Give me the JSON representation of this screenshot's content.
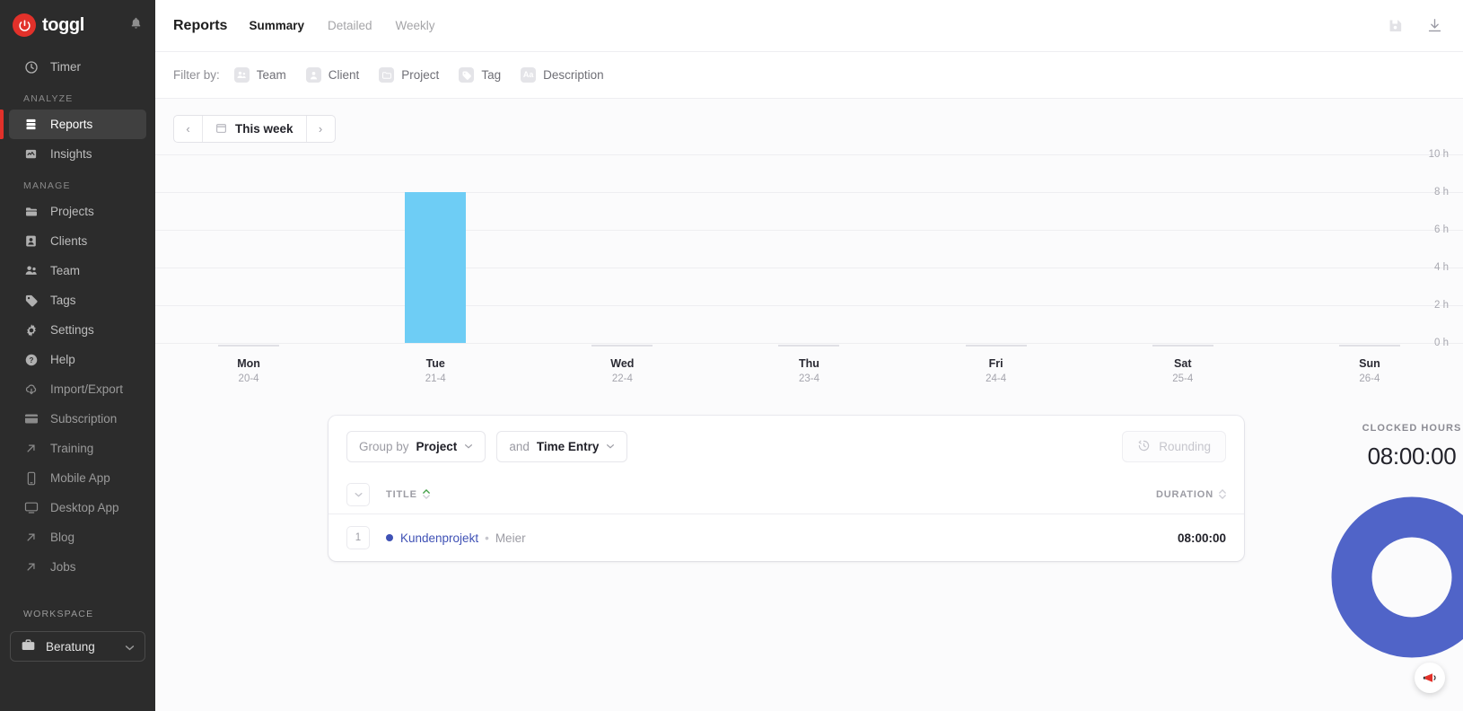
{
  "brand": {
    "name": "toggl",
    "logo_color": "#e2312a"
  },
  "sidebar": {
    "notification_icon": "bell-icon",
    "top_item": {
      "label": "Timer",
      "icon": "clock-icon"
    },
    "sections": [
      {
        "title": "ANALYZE",
        "items": [
          {
            "label": "Reports",
            "icon": "report-icon",
            "active": true
          },
          {
            "label": "Insights",
            "icon": "insights-icon",
            "active": false
          }
        ]
      },
      {
        "title": "MANAGE",
        "items": [
          {
            "label": "Projects",
            "icon": "folder-icon",
            "active": false
          },
          {
            "label": "Clients",
            "icon": "person-icon",
            "active": false
          },
          {
            "label": "Team",
            "icon": "people-icon",
            "active": false
          },
          {
            "label": "Tags",
            "icon": "tag-icon",
            "active": false
          },
          {
            "label": "Settings",
            "icon": "gear-icon",
            "active": false
          },
          {
            "label": "Help",
            "icon": "question-icon",
            "active": false
          },
          {
            "label": "Import/Export",
            "icon": "cloud-download-icon",
            "active": false
          },
          {
            "label": "Subscription",
            "icon": "card-icon",
            "active": false
          },
          {
            "label": "Training",
            "icon": "external-link-icon",
            "active": false
          },
          {
            "label": "Mobile App",
            "icon": "phone-icon",
            "active": false
          },
          {
            "label": "Desktop App",
            "icon": "monitor-icon",
            "active": false
          },
          {
            "label": "Blog",
            "icon": "external-link-icon",
            "active": false
          },
          {
            "label": "Jobs",
            "icon": "external-link-icon",
            "active": false
          }
        ]
      }
    ],
    "workspace_section_title": "WORKSPACE",
    "workspace": {
      "name": "Beratung",
      "icon": "briefcase-icon",
      "chevron": "chevron-down-icon"
    }
  },
  "header": {
    "title": "Reports",
    "tabs": [
      {
        "label": "Summary",
        "active": true
      },
      {
        "label": "Detailed",
        "active": false
      },
      {
        "label": "Weekly",
        "active": false
      }
    ],
    "actions": [
      {
        "name": "save-report-button",
        "icon": "floppy-disk-icon"
      },
      {
        "name": "export-report-button",
        "icon": "download-icon"
      }
    ]
  },
  "filters": {
    "label": "Filter by:",
    "chips": [
      {
        "label": "Team",
        "icon": "people-icon",
        "glyph": "⚉"
      },
      {
        "label": "Client",
        "icon": "person-icon",
        "glyph": "⚈"
      },
      {
        "label": "Project",
        "icon": "folder-icon",
        "glyph": "▭"
      },
      {
        "label": "Tag",
        "icon": "tag-icon",
        "glyph": "◆"
      },
      {
        "label": "Description",
        "icon": "text-icon",
        "glyph": "Aa"
      }
    ]
  },
  "date_range": {
    "prev_label": "‹",
    "next_label": "›",
    "value": "This week",
    "calendar_icon": "calendar-icon"
  },
  "chart_data": {
    "type": "bar",
    "title": "",
    "categories": [
      "Mon",
      "Tue",
      "Wed",
      "Thu",
      "Fri",
      "Sat",
      "Sun"
    ],
    "sub_labels": [
      "20-4",
      "21-4",
      "22-4",
      "23-4",
      "24-4",
      "25-4",
      "26-4"
    ],
    "values": [
      0,
      8,
      0,
      0,
      0,
      0,
      0
    ],
    "ylabel": "",
    "xlabel": "",
    "ylim": [
      0,
      10
    ],
    "yticks": [
      10,
      8,
      6,
      4,
      2,
      0
    ],
    "ytick_labels": [
      "10 h",
      "8 h",
      "6 h",
      "4 h",
      "2 h",
      "0 h"
    ],
    "bar_color": "#6ecdf5",
    "grid": true,
    "legend": false
  },
  "table": {
    "group_by": {
      "prefix": "Group by",
      "value": "Project",
      "chevron": "chevron-down-icon"
    },
    "sub_group_by": {
      "prefix": "and",
      "value": "Time Entry",
      "chevron": "chevron-down-icon"
    },
    "rounding": {
      "label": "Rounding",
      "icon": "rounding-clock-icon",
      "disabled": true
    },
    "columns": [
      {
        "label": "TITLE",
        "sort": "asc"
      },
      {
        "label": "DURATION",
        "sort": "none"
      }
    ],
    "rows": [
      {
        "index": "1",
        "project": "Kundenprojekt",
        "project_color": "#3f51b5",
        "separator": "•",
        "client": "Meier",
        "duration": "08:00:00"
      }
    ]
  },
  "summary": {
    "label": "CLOCKED HOURS",
    "value": "08:00:00",
    "donut": {
      "segments": [
        {
          "label": "Kundenprojekt",
          "value": 100,
          "color": "#5064c8"
        }
      ]
    }
  },
  "fab": {
    "name": "feedback-button",
    "icon": "megaphone-icon",
    "color": "#e2312a"
  }
}
